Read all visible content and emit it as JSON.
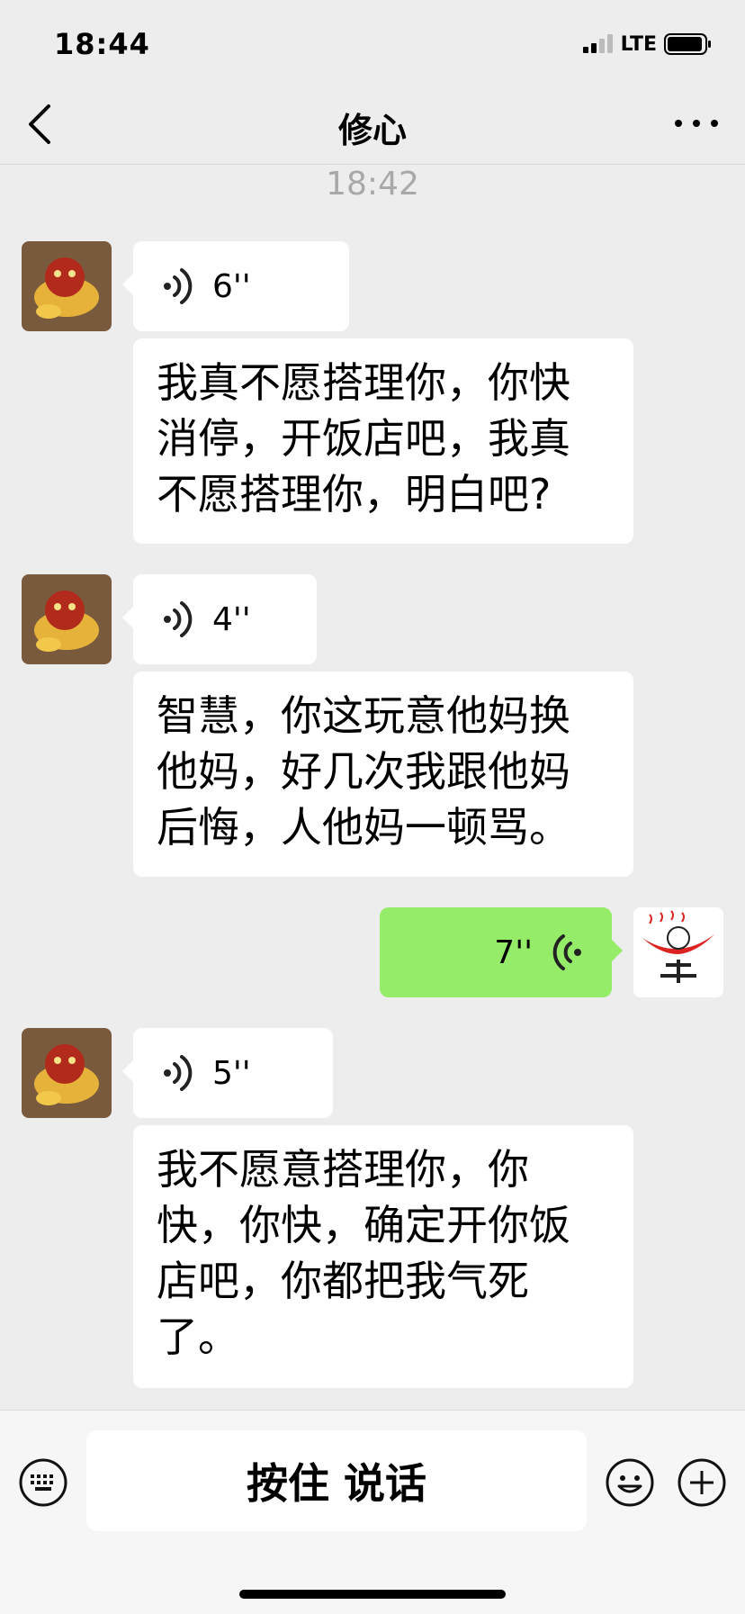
{
  "status_bar": {
    "time": "18:44",
    "network": "LTE"
  },
  "nav": {
    "title": "修心"
  },
  "timestamp": "18:42",
  "messages": [
    {
      "voice_duration": "6''",
      "transcript": "我真不愿搭理你，你快消停，开饭店吧，我真不愿搭理你，明白吧?"
    },
    {
      "voice_duration": "4''",
      "transcript": "智慧，你这玩意他妈换他妈，好几次我跟他妈后悔，人他妈一顿骂。"
    },
    {
      "voice_duration": "7''"
    },
    {
      "voice_duration": "5''",
      "transcript": "我不愿意搭理你，你快，你快，确定开你饭店吧，你都把我气死了。"
    }
  ],
  "input_bar": {
    "hold_to_talk": "按住 说话"
  },
  "colors": {
    "background": "#ededed",
    "outgoing_bubble": "#95ec69",
    "incoming_bubble": "#ffffff"
  },
  "icons": [
    "back-icon",
    "more-icon",
    "voice-wave-icon",
    "keyboard-icon",
    "emoji-icon",
    "add-icon",
    "signal-icon",
    "battery-icon"
  ]
}
